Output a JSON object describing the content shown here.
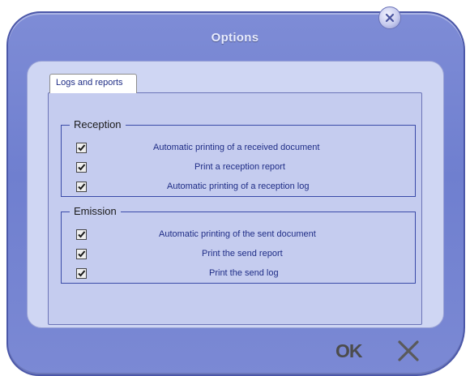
{
  "window": {
    "title": "Options"
  },
  "tabs": [
    {
      "label": "Logs and reports"
    }
  ],
  "reception": {
    "title": "Reception",
    "items": [
      {
        "label": "Automatic printing of a received document",
        "checked": true
      },
      {
        "label": "Print a reception report",
        "checked": true
      },
      {
        "label": "Automatic printing of a reception log",
        "checked": true
      }
    ]
  },
  "emission": {
    "title": "Emission",
    "items": [
      {
        "label": "Automatic printing of the sent document",
        "checked": true
      },
      {
        "label": "Print the send report",
        "checked": true
      },
      {
        "label": "Print the send log",
        "checked": true
      }
    ]
  },
  "footer": {
    "ok_label": "OK"
  },
  "icons": {
    "close_top": "close-icon",
    "cancel": "cancel-x-icon",
    "check": "checkmark-icon"
  },
  "colors": {
    "frame": "#7381d2",
    "panel": "#cfd6f3",
    "tab_body": "#c5ccef",
    "group_border": "#3a4aa8",
    "label_text": "#1f2d86"
  }
}
